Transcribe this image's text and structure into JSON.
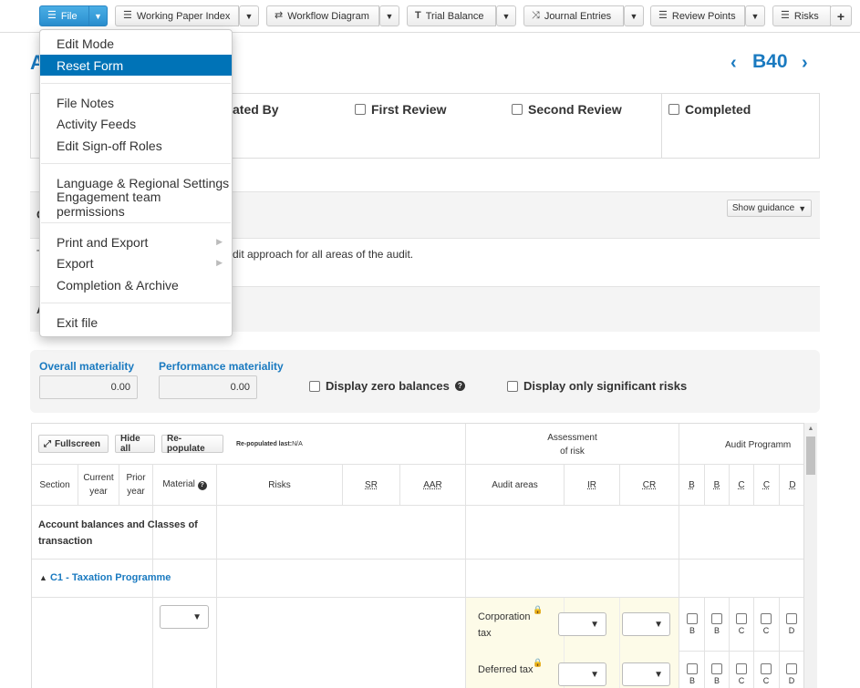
{
  "toolbar": {
    "file": "File",
    "working_paper_index": "Working Paper Index",
    "workflow_diagram": "Workflow Diagram",
    "trial_balance": "Trial Balance",
    "journal_entries": "Journal Entries",
    "review_points": "Review Points",
    "risks": "Risks"
  },
  "file_menu": {
    "edit_mode": "Edit Mode",
    "reset_form": "Reset Form",
    "file_notes": "File Notes",
    "activity_feeds": "Activity Feeds",
    "edit_signoff_roles": "Edit Sign-off Roles",
    "language_settings": "Language & Regional Settings",
    "team_permissions": "Engagement team permissions",
    "print_export": "Print and Export",
    "export": "Export",
    "completion_archive": "Completion & Archive",
    "exit_file": "Exit file"
  },
  "header": {
    "title_initial": "A",
    "code": "B40"
  },
  "signoff": {
    "prepared_by": "ated By",
    "first_review": "First Review",
    "second_review": "Second Review",
    "completed": "Completed"
  },
  "guidance": {
    "show_guidance": "Show guidance",
    "left_letter": "C",
    "text": "dit approach for all areas of the audit.",
    "text_left": "T",
    "section_letter": "A"
  },
  "materiality": {
    "overall_label": "Overall materiality",
    "overall_value": "0.00",
    "performance_label": "Performance materiality",
    "performance_value": "0.00",
    "display_zero": "Display zero balances",
    "display_significant": "Display only significant risks"
  },
  "table_toolbar": {
    "fullscreen": "Fullscreen",
    "hide_all": "Hide all",
    "repopulate": "Re-populate",
    "repopulated_label": "Re-populated last:",
    "repopulated_value": "N/A"
  },
  "table_headers": {
    "assessment_line1": "Assessment",
    "assessment_line2": "of risk",
    "audit_program": "Audit Programm",
    "section": "Section",
    "current_year_1": "Current",
    "current_year_2": "year",
    "prior_year_1": "Prior",
    "prior_year_2": "year",
    "material": "Material",
    "risks": "Risks",
    "sr": "SR",
    "aar": "AAR",
    "audit_areas": "Audit areas",
    "ir": "IR",
    "cr": "CR",
    "prog_cols": [
      "B",
      "B",
      "C",
      "C",
      "D"
    ]
  },
  "table_rows": {
    "group_1": "Account balances and Classes of",
    "group_2": "transaction",
    "programme": "C1 - Taxation Programme",
    "area_1a": "Corporation",
    "area_1b": "tax",
    "area_2": "Deferred tax"
  }
}
